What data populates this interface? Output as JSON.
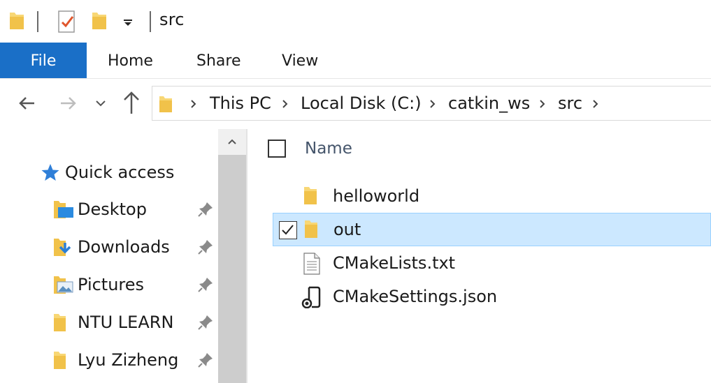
{
  "window": {
    "title": "src"
  },
  "quick_access_toolbar": {
    "icons": [
      "folder-icon",
      "properties-icon",
      "new-folder-icon",
      "customize-dropdown-icon"
    ]
  },
  "ribbon": {
    "tabs": [
      {
        "label": "File",
        "active": true
      },
      {
        "label": "Home"
      },
      {
        "label": "Share"
      },
      {
        "label": "View"
      }
    ],
    "accent": "#1a6fc7"
  },
  "address_bar": {
    "breadcrumbs": [
      "This PC",
      "Local Disk (C:)",
      "catkin_ws",
      "src"
    ]
  },
  "nav_pane": {
    "quick_access_label": "Quick access",
    "items": [
      {
        "label": "Desktop",
        "icon": "desktop-folder-icon",
        "pinned": true
      },
      {
        "label": "Downloads",
        "icon": "downloads-folder-icon",
        "pinned": true
      },
      {
        "label": "Pictures",
        "icon": "pictures-folder-icon",
        "pinned": true
      },
      {
        "label": "NTU LEARN",
        "icon": "folder-icon",
        "pinned": true
      },
      {
        "label": "Lyu Zizheng",
        "icon": "folder-icon",
        "pinned": true
      }
    ]
  },
  "content": {
    "column_header": "Name",
    "files": [
      {
        "name": "helloworld",
        "icon": "folder-icon",
        "selected": false
      },
      {
        "name": "out",
        "icon": "folder-icon",
        "selected": true
      },
      {
        "name": "CMakeLists.txt",
        "icon": "text-file-icon",
        "selected": false
      },
      {
        "name": "CMakeSettings.json",
        "icon": "json-file-icon",
        "selected": false
      }
    ],
    "selection_color": "#cce8ff"
  }
}
